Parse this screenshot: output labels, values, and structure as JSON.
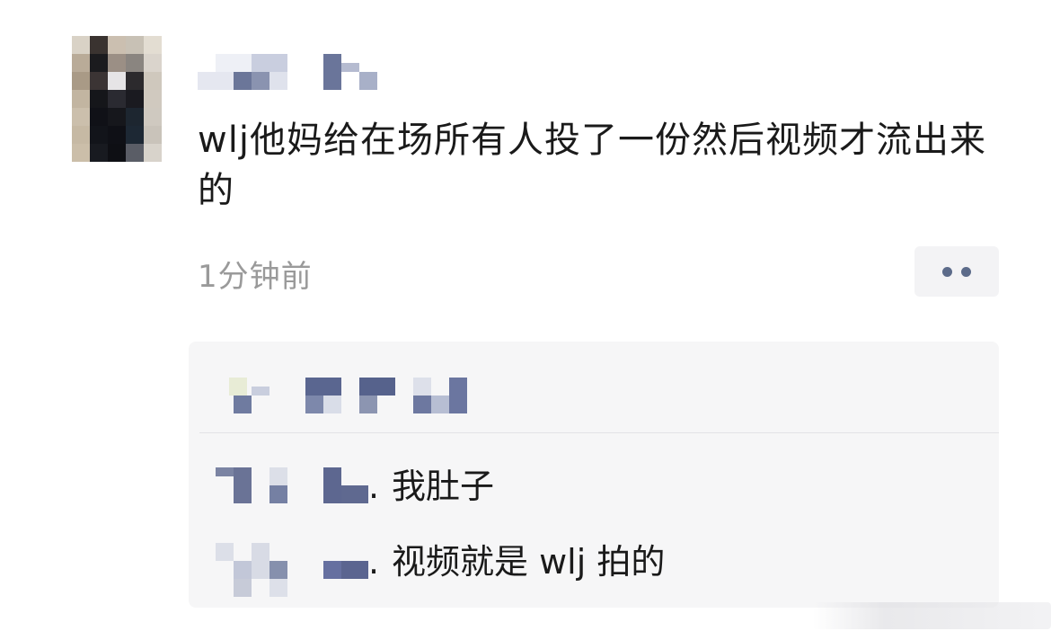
{
  "post": {
    "content": "wlj他妈给在场所有人投了一份然后视频才流出来的",
    "time": "1分钟前"
  },
  "icons": {
    "avatar": "pixelated-avatar",
    "username": "pixelated-username",
    "more": "more-dots-icon"
  },
  "likes": {
    "names_hidden": true
  },
  "comments": [
    {
      "separator": ".",
      "text": "我肚子"
    },
    {
      "separator": ".",
      "text": "视频就是 wlj 拍的"
    }
  ],
  "colors": {
    "text": "#1a1a1a",
    "timestamp": "#9a9a9a",
    "link_blue": "#5c6b8a",
    "comment_bg": "#f6f6f7"
  }
}
